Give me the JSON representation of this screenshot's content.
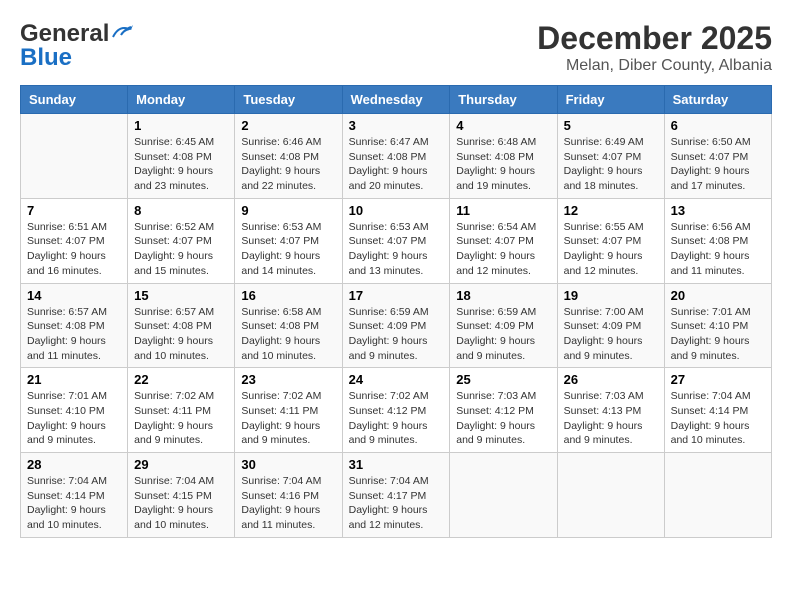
{
  "header": {
    "logo_line1": "General",
    "logo_line2": "Blue",
    "month": "December 2025",
    "location": "Melan, Diber County, Albania"
  },
  "columns": [
    "Sunday",
    "Monday",
    "Tuesday",
    "Wednesday",
    "Thursday",
    "Friday",
    "Saturday"
  ],
  "weeks": [
    [
      {
        "day": "",
        "info": ""
      },
      {
        "day": "1",
        "info": "Sunrise: 6:45 AM\nSunset: 4:08 PM\nDaylight: 9 hours\nand 23 minutes."
      },
      {
        "day": "2",
        "info": "Sunrise: 6:46 AM\nSunset: 4:08 PM\nDaylight: 9 hours\nand 22 minutes."
      },
      {
        "day": "3",
        "info": "Sunrise: 6:47 AM\nSunset: 4:08 PM\nDaylight: 9 hours\nand 20 minutes."
      },
      {
        "day": "4",
        "info": "Sunrise: 6:48 AM\nSunset: 4:08 PM\nDaylight: 9 hours\nand 19 minutes."
      },
      {
        "day": "5",
        "info": "Sunrise: 6:49 AM\nSunset: 4:07 PM\nDaylight: 9 hours\nand 18 minutes."
      },
      {
        "day": "6",
        "info": "Sunrise: 6:50 AM\nSunset: 4:07 PM\nDaylight: 9 hours\nand 17 minutes."
      }
    ],
    [
      {
        "day": "7",
        "info": "Sunrise: 6:51 AM\nSunset: 4:07 PM\nDaylight: 9 hours\nand 16 minutes."
      },
      {
        "day": "8",
        "info": "Sunrise: 6:52 AM\nSunset: 4:07 PM\nDaylight: 9 hours\nand 15 minutes."
      },
      {
        "day": "9",
        "info": "Sunrise: 6:53 AM\nSunset: 4:07 PM\nDaylight: 9 hours\nand 14 minutes."
      },
      {
        "day": "10",
        "info": "Sunrise: 6:53 AM\nSunset: 4:07 PM\nDaylight: 9 hours\nand 13 minutes."
      },
      {
        "day": "11",
        "info": "Sunrise: 6:54 AM\nSunset: 4:07 PM\nDaylight: 9 hours\nand 12 minutes."
      },
      {
        "day": "12",
        "info": "Sunrise: 6:55 AM\nSunset: 4:07 PM\nDaylight: 9 hours\nand 12 minutes."
      },
      {
        "day": "13",
        "info": "Sunrise: 6:56 AM\nSunset: 4:08 PM\nDaylight: 9 hours\nand 11 minutes."
      }
    ],
    [
      {
        "day": "14",
        "info": "Sunrise: 6:57 AM\nSunset: 4:08 PM\nDaylight: 9 hours\nand 11 minutes."
      },
      {
        "day": "15",
        "info": "Sunrise: 6:57 AM\nSunset: 4:08 PM\nDaylight: 9 hours\nand 10 minutes."
      },
      {
        "day": "16",
        "info": "Sunrise: 6:58 AM\nSunset: 4:08 PM\nDaylight: 9 hours\nand 10 minutes."
      },
      {
        "day": "17",
        "info": "Sunrise: 6:59 AM\nSunset: 4:09 PM\nDaylight: 9 hours\nand 9 minutes."
      },
      {
        "day": "18",
        "info": "Sunrise: 6:59 AM\nSunset: 4:09 PM\nDaylight: 9 hours\nand 9 minutes."
      },
      {
        "day": "19",
        "info": "Sunrise: 7:00 AM\nSunset: 4:09 PM\nDaylight: 9 hours\nand 9 minutes."
      },
      {
        "day": "20",
        "info": "Sunrise: 7:01 AM\nSunset: 4:10 PM\nDaylight: 9 hours\nand 9 minutes."
      }
    ],
    [
      {
        "day": "21",
        "info": "Sunrise: 7:01 AM\nSunset: 4:10 PM\nDaylight: 9 hours\nand 9 minutes."
      },
      {
        "day": "22",
        "info": "Sunrise: 7:02 AM\nSunset: 4:11 PM\nDaylight: 9 hours\nand 9 minutes."
      },
      {
        "day": "23",
        "info": "Sunrise: 7:02 AM\nSunset: 4:11 PM\nDaylight: 9 hours\nand 9 minutes."
      },
      {
        "day": "24",
        "info": "Sunrise: 7:02 AM\nSunset: 4:12 PM\nDaylight: 9 hours\nand 9 minutes."
      },
      {
        "day": "25",
        "info": "Sunrise: 7:03 AM\nSunset: 4:12 PM\nDaylight: 9 hours\nand 9 minutes."
      },
      {
        "day": "26",
        "info": "Sunrise: 7:03 AM\nSunset: 4:13 PM\nDaylight: 9 hours\nand 9 minutes."
      },
      {
        "day": "27",
        "info": "Sunrise: 7:04 AM\nSunset: 4:14 PM\nDaylight: 9 hours\nand 10 minutes."
      }
    ],
    [
      {
        "day": "28",
        "info": "Sunrise: 7:04 AM\nSunset: 4:14 PM\nDaylight: 9 hours\nand 10 minutes."
      },
      {
        "day": "29",
        "info": "Sunrise: 7:04 AM\nSunset: 4:15 PM\nDaylight: 9 hours\nand 10 minutes."
      },
      {
        "day": "30",
        "info": "Sunrise: 7:04 AM\nSunset: 4:16 PM\nDaylight: 9 hours\nand 11 minutes."
      },
      {
        "day": "31",
        "info": "Sunrise: 7:04 AM\nSunset: 4:17 PM\nDaylight: 9 hours\nand 12 minutes."
      },
      {
        "day": "",
        "info": ""
      },
      {
        "day": "",
        "info": ""
      },
      {
        "day": "",
        "info": ""
      }
    ]
  ]
}
